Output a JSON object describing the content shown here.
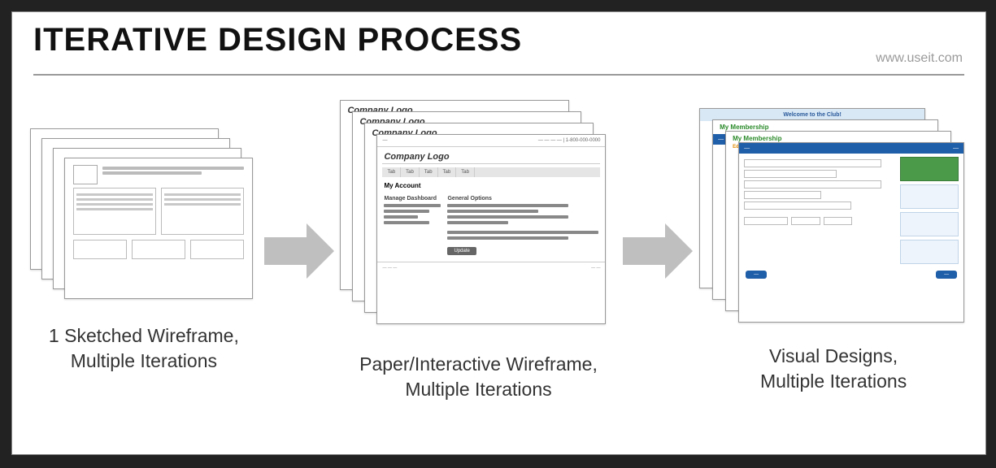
{
  "header": {
    "title": "ITERATIVE DESIGN PROCESS",
    "credit": "www.useit.com"
  },
  "stages": {
    "sketch": {
      "caption_l1": "1 Sketched Wireframe,",
      "caption_l2": "Multiple Iterations"
    },
    "wire": {
      "caption_l1": "Paper/Interactive Wireframe,",
      "caption_l2": "Multiple Iterations",
      "logo_label": "Company Logo",
      "section_title": "My Account",
      "side_heading": "Manage Dashboard",
      "main_heading": "General Options",
      "button_label": "Update"
    },
    "visual": {
      "caption_l1": "Visual Designs,",
      "caption_l2": "Multiple Iterations",
      "welcome": "Welcome to the Club!",
      "heading": "My Membership",
      "subheading": "Edit Personal Information"
    }
  }
}
